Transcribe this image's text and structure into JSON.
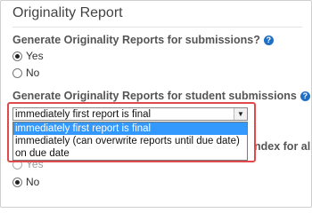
{
  "section_title": "Originality Report",
  "question1": {
    "label": "Generate Originality Reports for submissions?",
    "options": [
      "Yes",
      "No"
    ],
    "selected": "Yes"
  },
  "question2": {
    "label": "Generate Originality Reports for student submissions",
    "selected_value": "immediately first report is final",
    "dropdown_options": [
      "immediately first report is final",
      "immediately (can overwrite reports until due date)",
      "on due date"
    ]
  },
  "question3": {
    "label_fragment": "ndex for all",
    "options": [
      "Yes",
      "No"
    ],
    "selected": "No"
  },
  "help_glyph": "?",
  "dropdown_arrow_glyph": "▼",
  "highlight_color": "#e04a4a",
  "accent_color": "#1f6fc4",
  "selected_option_bg": "#3399ff"
}
